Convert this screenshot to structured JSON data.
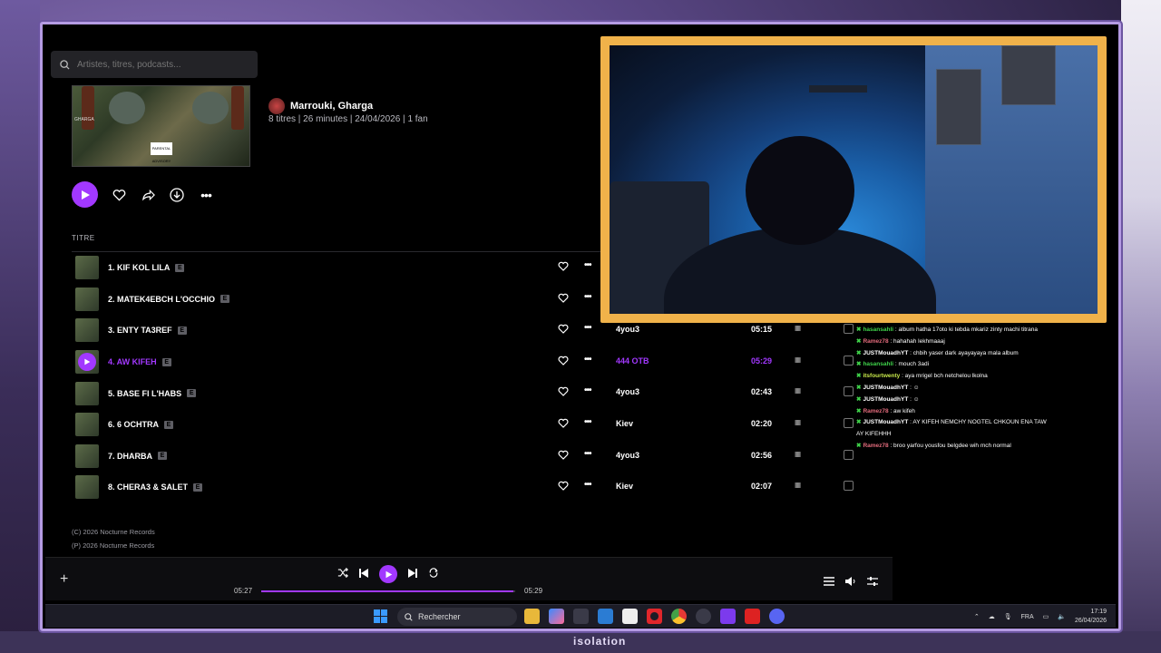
{
  "search": {
    "placeholder": "Artistes, titres, podcasts..."
  },
  "album": {
    "artists": "Marrouki, Gharga",
    "meta": "8 titres | 26 minutes | 24/04/2026 | 1 fan",
    "cover_text": "GHARGA"
  },
  "tracklist": {
    "column_title": "TITRE",
    "explicit_badge": "E",
    "tracks": [
      {
        "title": "1. KIF KOL LILA",
        "artist": "",
        "duration": "",
        "active": false
      },
      {
        "title": "2. MATEK4EBCH L'OCCHIO",
        "artist": "",
        "duration": "",
        "active": false
      },
      {
        "title": "3. ENTY TA3REF",
        "artist": "4you3",
        "duration": "05:15",
        "active": false
      },
      {
        "title": "4. AW KIFEH",
        "artist": "444 OTB",
        "duration": "05:29",
        "active": true
      },
      {
        "title": "5. BASE FI L'HABS",
        "artist": "4you3",
        "duration": "02:43",
        "active": false
      },
      {
        "title": "6. 6 OCHTRA",
        "artist": "Kiev",
        "duration": "02:20",
        "active": false
      },
      {
        "title": "7. DHARBA",
        "artist": "4you3",
        "duration": "02:56",
        "active": false
      },
      {
        "title": "8. CHERA3 & SALET",
        "artist": "Kiev",
        "duration": "02:07",
        "active": false
      }
    ],
    "popularity_glyph": "IIIII"
  },
  "copyright": {
    "c_line": "(C) 2026 Nocturne Records",
    "p_line": "(P) 2026 Nocturne Records"
  },
  "player": {
    "elapsed": "05:27",
    "total": "05:29",
    "progress": 0.994
  },
  "chat": [
    {
      "user": "hasansahli",
      "user_color": "#3fd24a",
      "text": " : album hatha 17oto ki tebda mkariz zinty machi titrana"
    },
    {
      "user": "Ramez78",
      "user_color": "#e26b7c",
      "text": " : hahahah lekhmaaaj"
    },
    {
      "user": "JUSTMouadhYT",
      "user_color": "#ffffff",
      "text": " : chbih yaser dark ayayayaya mala album"
    },
    {
      "user": "hasansahli",
      "user_color": "#3fd24a",
      "text": " : mouch 3adi"
    },
    {
      "user": "itsfourtwenty",
      "user_color": "#c7e84a",
      "text": " : aya mrigel bch netchelou lkolna"
    },
    {
      "user": "JUSTMouadhYT",
      "user_color": "#ffffff",
      "text": " : ☺"
    },
    {
      "user": "JUSTMouadhYT",
      "user_color": "#ffffff",
      "text": " : ☺"
    },
    {
      "user": "Ramez78",
      "user_color": "#e26b7c",
      "text": " : aw kifeh"
    },
    {
      "user": "JUSTMouadhYT",
      "user_color": "#ffffff",
      "text": " : AY KIFEH NEMCHY NOGTEL CHKOUN ENA TAW AY KIFEHHH"
    },
    {
      "user": "Ramez78",
      "user_color": "#e26b7c",
      "text": " : broo yarfou yousfou belgdee wih mch normal"
    }
  ],
  "taskbar": {
    "search_label": "Rechercher",
    "lang": "FRA",
    "time": "17:19",
    "date": "26/04/2026"
  },
  "overlay": {
    "brand_text": "isolation"
  },
  "colors": {
    "accent": "#a238ff",
    "webcam_border": "#f0b24a"
  }
}
